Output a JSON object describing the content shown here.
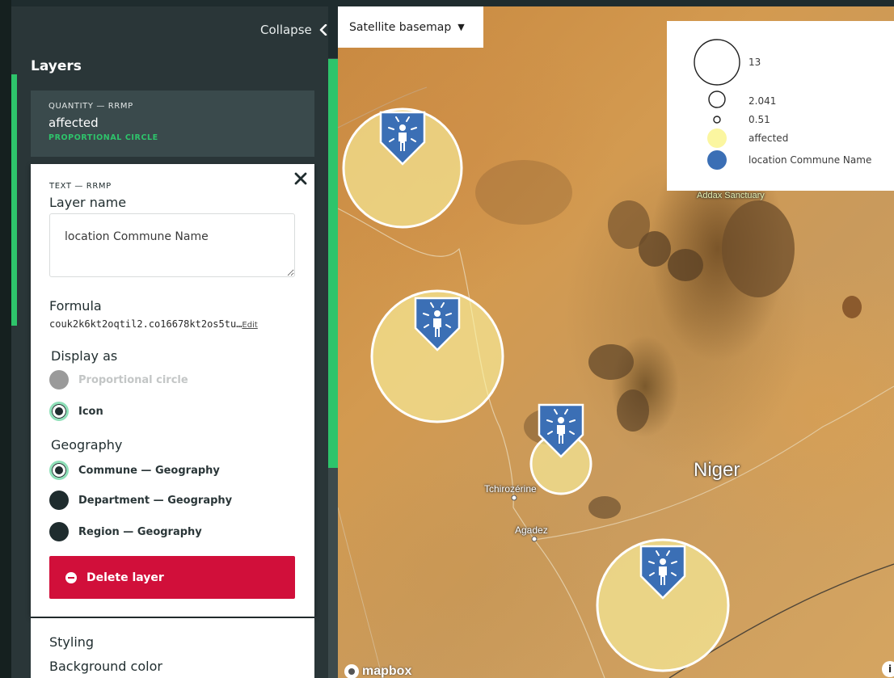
{
  "sidebar": {
    "collapse_label": "Collapse",
    "layers_title": "Layers",
    "layer_card": {
      "kicker": "QUANTITY — RRMP",
      "name": "affected",
      "type": "PROPORTIONAL CIRCLE"
    }
  },
  "layer_panel": {
    "kicker": "TEXT — RRMP",
    "layer_name_label": "Layer name",
    "layer_name_value": "location Commune Name",
    "formula_label": "Formula",
    "formula_value": "couk2k6kt2oqtil2.co16678kt2os5tu…",
    "formula_edit": "Edit",
    "display_as": {
      "title": "Display as",
      "options": [
        {
          "label": "Proportional circle",
          "state": "disabled"
        },
        {
          "label": "Icon",
          "state": "selected"
        }
      ]
    },
    "geography": {
      "title": "Geography",
      "options": [
        {
          "label": "Commune — Geography",
          "state": "selected"
        },
        {
          "label": "Department — Geography",
          "state": "unselected"
        },
        {
          "label": "Region — Geography",
          "state": "unselected"
        }
      ]
    },
    "delete_label": "Delete layer"
  },
  "styling": {
    "title": "Styling",
    "background_color_label": "Background color"
  },
  "map": {
    "basemap_label": "Satellite basemap",
    "legend": [
      {
        "kind": "circle-size",
        "label": "13"
      },
      {
        "kind": "circle-size",
        "label": "2.041"
      },
      {
        "kind": "circle-size",
        "label": "0.51"
      },
      {
        "kind": "color",
        "color": "#fbf6a0",
        "label": "affected"
      },
      {
        "kind": "color",
        "color": "#3b6fb5",
        "label": "location Commune Name"
      }
    ],
    "places": {
      "country": "Niger",
      "town1": "Tchirozérine",
      "town2": "Agadez",
      "sanctuary": "Addax Sanctuary"
    },
    "attribution": "mapbox",
    "info_glyph": "i",
    "markers": [
      {
        "icon": "person-alert-icon",
        "affected": "large"
      },
      {
        "icon": "person-alert-icon",
        "affected": "large"
      },
      {
        "icon": "person-alert-icon",
        "affected": "small"
      },
      {
        "icon": "person-alert-icon",
        "affected": "large"
      }
    ]
  },
  "colors": {
    "accent": "#2ec46b",
    "danger": "#d10f3a",
    "marker_blue": "#3b6fb5",
    "circle_fill": "#fbf6a0",
    "sidebar_bg": "#2a3638"
  }
}
